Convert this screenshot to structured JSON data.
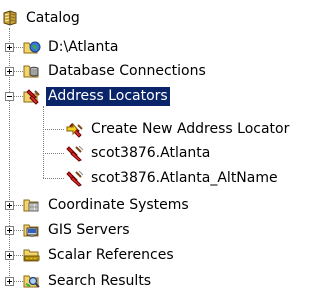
{
  "tree": {
    "root": {
      "label": "Catalog",
      "icon": "catalog-icon"
    },
    "items": [
      {
        "label": "D:\\Atlanta",
        "icon": "folder-globe-icon",
        "expander": "plus"
      },
      {
        "label": "Database Connections",
        "icon": "database-connections-icon",
        "expander": "plus"
      },
      {
        "label": "Address Locators",
        "icon": "address-locators-icon",
        "expander": "minus",
        "selected": true,
        "children": [
          {
            "label": "Create New Address Locator",
            "icon": "create-locator-icon"
          },
          {
            "label": "scot3876.Atlanta",
            "icon": "address-locator-icon"
          },
          {
            "label": "scot3876.Atlanta_AltName",
            "icon": "address-locator-icon"
          }
        ]
      },
      {
        "label": "Coordinate Systems",
        "icon": "coordinate-systems-icon",
        "expander": "plus"
      },
      {
        "label": "GIS Servers",
        "icon": "gis-servers-icon",
        "expander": "plus"
      },
      {
        "label": "Scalar References",
        "icon": "scalar-references-icon",
        "expander": "plus"
      },
      {
        "label": "Search Results",
        "icon": "search-results-icon",
        "expander": "plus"
      }
    ]
  },
  "colors": {
    "selection_bg": "#0a246a",
    "selection_text": "#ffffff",
    "connector": "#808080"
  }
}
